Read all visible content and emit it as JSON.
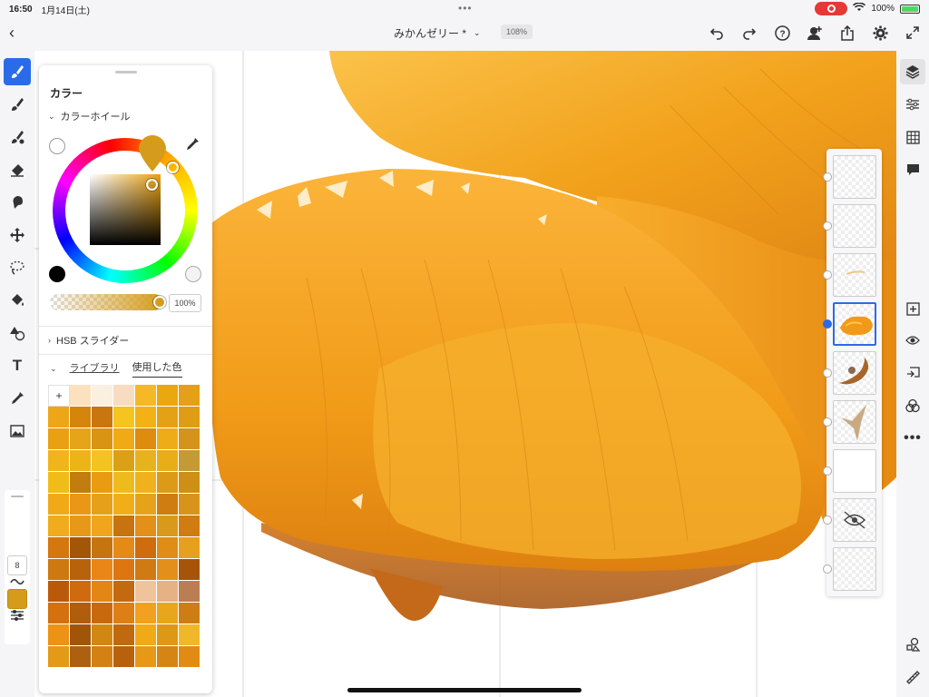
{
  "status": {
    "time": "16:50",
    "date": "1月14日(土)",
    "battery": "100%"
  },
  "header": {
    "doc_title": "みかんゼリー *",
    "zoom": "108%"
  },
  "left_rail": {
    "brush_size": "8"
  },
  "color_panel": {
    "title": "カラー",
    "wheel_section": "カラーホイール",
    "opacity": "100%",
    "hsb_section": "HSB スライダー",
    "tab_library": "ライブラリ",
    "tab_used": "使用した色",
    "add_symbol": "+",
    "current_color": "#d49c1a",
    "swatches": [
      [
        "#fbe1bd",
        "#fbefe0",
        "#f7dcc2",
        "#f5b826",
        "#e9a810",
        "#e4a018"
      ],
      [
        "#eea619",
        "#d4850c",
        "#c97510",
        "#f4c41f",
        "#f3b116",
        "#e5a116",
        "#df9c15"
      ],
      [
        "#e9a013",
        "#e6a419",
        "#d89412",
        "#efaa16",
        "#dd8c10",
        "#efac19",
        "#d4931a"
      ],
      [
        "#f2b41b",
        "#edb418",
        "#f4c321",
        "#dca017",
        "#e6b21e",
        "#e8ad18",
        "#c49a35"
      ],
      [
        "#f0bc18",
        "#c27d0e",
        "#ea9b12",
        "#edbc1c",
        "#efb21c",
        "#dd9a16",
        "#cd8f15"
      ],
      [
        "#f2a918",
        "#ea9616",
        "#e7a01a",
        "#f1ae19",
        "#e6a319",
        "#cf7c10",
        "#d8941a"
      ],
      [
        "#f0ac1c",
        "#e89819",
        "#f1a51c",
        "#c67310",
        "#e3901a",
        "#d99a1b",
        "#d07c11"
      ],
      [
        "#d3780d",
        "#a35608",
        "#c57510",
        "#e38a17",
        "#ce6c0e",
        "#e08d17",
        "#e6a01d"
      ],
      [
        "#ce7810",
        "#b8620c",
        "#ea8617",
        "#dd7610",
        "#cf7a13",
        "#e2901b",
        "#a6540a"
      ],
      [
        "#b95a0b",
        "#cf6b0e",
        "#e28616",
        "#c36a10",
        "#efc49a",
        "#e5b185",
        "#bb7e52"
      ],
      [
        "#d4700e",
        "#b05d0c",
        "#c9690d",
        "#dd7f14",
        "#f39f1f",
        "#e9a51b",
        "#cd7d14"
      ],
      [
        "#ec9214",
        "#a1550b",
        "#d18714",
        "#c06a0f",
        "#f0aa18",
        "#dd9818",
        "#f1b72b"
      ],
      [
        "#e39a16",
        "#ad6110",
        "#d48114",
        "#b7610c",
        "#e89817",
        "#d58514",
        "#e28b14"
      ]
    ]
  },
  "canvas": {
    "fruit_colors": [
      "#f5a91c",
      "#f19b18",
      "#e88915",
      "#fbc64a",
      "#d57413",
      "#b5641a"
    ]
  },
  "layers": [
    {
      "thumb": "empty"
    },
    {
      "thumb": "empty"
    },
    {
      "thumb": "faint"
    },
    {
      "thumb": "orange-fruit",
      "selected": true
    },
    {
      "thumb": "brown-swirl"
    },
    {
      "thumb": "tan-shape"
    },
    {
      "thumb": "blank-white"
    },
    {
      "thumb": "hidden-eye"
    },
    {
      "thumb": "empty"
    }
  ],
  "icons": {
    "top": [
      "undo-icon",
      "redo-icon",
      "help-icon",
      "invite-user-icon",
      "share-icon",
      "settings-icon",
      "fullscreen-icon"
    ],
    "left": [
      "paint-brush-icon",
      "pixel-brush-icon",
      "live-brush-icon",
      "eraser-icon",
      "smudge-icon",
      "move-icon",
      "lasso-icon",
      "fill-icon",
      "shapes-icon",
      "text-icon",
      "eyedropper-icon",
      "image-icon"
    ],
    "right": [
      "layers-icon",
      "adjustments-icon",
      "grid-icon",
      "comment-icon",
      "add-layer-icon",
      "visibility-icon",
      "import-icon",
      "blend-icon",
      "more-icon",
      "shape-tools-icon",
      "ruler-icon"
    ]
  }
}
